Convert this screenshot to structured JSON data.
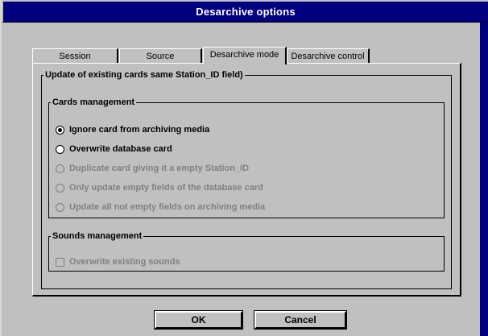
{
  "window": {
    "title": "Desarchive options"
  },
  "tabs": [
    {
      "label": "Session",
      "active": false
    },
    {
      "label": "Source",
      "active": false
    },
    {
      "label": "Desarchive mode",
      "active": true
    },
    {
      "label": "Desarchive control",
      "active": false
    }
  ],
  "update_group": {
    "title": "Update of existing cards same Station_ID field)"
  },
  "cards_group": {
    "title": "Cards management",
    "options": [
      {
        "label": "Ignore card from archiving media",
        "selected": true,
        "enabled": true
      },
      {
        "label": "Overwrite database card",
        "selected": false,
        "enabled": true
      },
      {
        "label": "Duplicate card giving it a empty Station_ID",
        "selected": false,
        "enabled": false
      },
      {
        "label": "Only update empty fields of the database card",
        "selected": false,
        "enabled": false
      },
      {
        "label": "Update all not empty fields on archiving media",
        "selected": false,
        "enabled": false
      }
    ]
  },
  "sounds_group": {
    "title": "Sounds management",
    "overwrite_sounds": {
      "label": "Overwrite existing sounds",
      "checked": false,
      "enabled": false
    }
  },
  "buttons": {
    "ok": "OK",
    "cancel": "Cancel"
  },
  "colors": {
    "title_bar": "#000080",
    "face": "#c0c0c0",
    "disabled_text": "#808080"
  }
}
